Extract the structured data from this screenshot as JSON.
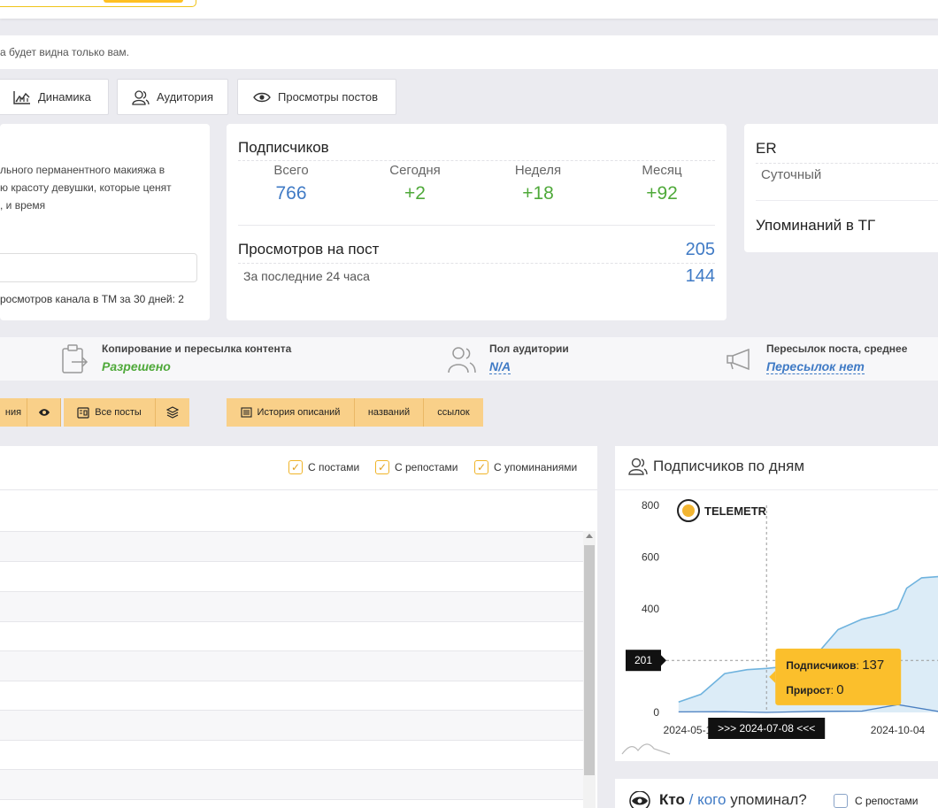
{
  "notice": {
    "text": "а будет видна только вам."
  },
  "tabs": [
    {
      "label": "Динамика",
      "icon": "chart-icon"
    },
    {
      "label": "Аудитория",
      "icon": "users-icon"
    },
    {
      "label": "Просмотры постов",
      "icon": "eye-icon"
    }
  ],
  "description": {
    "line1": "льного перманентного макияжа в",
    "line2": "",
    "line3": "ю красоту девушки, которые ценят",
    "line4": ", и время",
    "footer": "росмотров канала в ТМ за 30 дней: 2"
  },
  "subscribers": {
    "title": "Подписчиков",
    "stats": [
      {
        "label": "Всего",
        "value": "766"
      },
      {
        "label": "Сегодня",
        "value": "+2"
      },
      {
        "label": "Неделя",
        "value": "+18"
      },
      {
        "label": "Месяц",
        "value": "+92"
      }
    ],
    "views_title": "Просмотров на пост",
    "views_value": "205",
    "views_sub": "За последние 24 часа",
    "views_sub_value": "144"
  },
  "er": {
    "title": "ER",
    "sub": "Суточный",
    "mentions": "Упоминаний в ТГ"
  },
  "infobar": [
    {
      "label": "Копирование и пересылка контента",
      "value": "Разрешено"
    },
    {
      "label": "Пол аудитории",
      "value": "N/A"
    },
    {
      "label": "Пересылок поста, среднее",
      "value": "Пересылок нет"
    }
  ],
  "buttons": {
    "frag": "ния",
    "all_posts": "Все посты",
    "history": "История описаний",
    "names": "названий",
    "links": "ссылок"
  },
  "checkboxes": [
    "С постами",
    "С репостами",
    "С упоминаниями"
  ],
  "chart_panel": {
    "title": "Подписчиков по дням",
    "brand": "TELEMETR"
  },
  "chart_data": {
    "type": "area",
    "title": "",
    "xlabel": "",
    "ylabel": "",
    "ylim": [
      0,
      800
    ],
    "y_ticks": [
      "800",
      "600",
      "400",
      "0"
    ],
    "x_ticks": [
      "2024-05-1",
      "2024-10-04"
    ],
    "series": [
      {
        "x": [
          "2024-05-10",
          "2024-05-25",
          "2024-06-10",
          "2024-06-25",
          "2024-07-08",
          "2024-07-25",
          "2024-08-10",
          "2024-08-25",
          "2024-09-10",
          "2024-09-25",
          "2024-10-04",
          "2024-10-10",
          "2024-10-20",
          "2024-11-01"
        ],
        "values": [
          40,
          70,
          150,
          165,
          170,
          180,
          220,
          320,
          360,
          380,
          400,
          480,
          520,
          525
        ]
      },
      {
        "x": [
          "2024-05-10",
          "2024-06-10",
          "2024-07-08",
          "2024-08-10",
          "2024-09-10",
          "2024-10-04",
          "2024-11-01"
        ],
        "values": [
          2,
          3,
          0,
          4,
          5,
          30,
          3
        ]
      }
    ],
    "crosshair_y": "201",
    "tooltip": {
      "date": ">>> 2024-07-08 <<<",
      "subs_label": "Подписчиков",
      "subs_value": "137",
      "gain_label": "Прирост",
      "gain_value": "0"
    }
  },
  "mentions_panel": {
    "title": "Кто",
    "slash": "/",
    "whom": "кого",
    "tail": "упоминал?",
    "checkbox": "С репостами"
  }
}
